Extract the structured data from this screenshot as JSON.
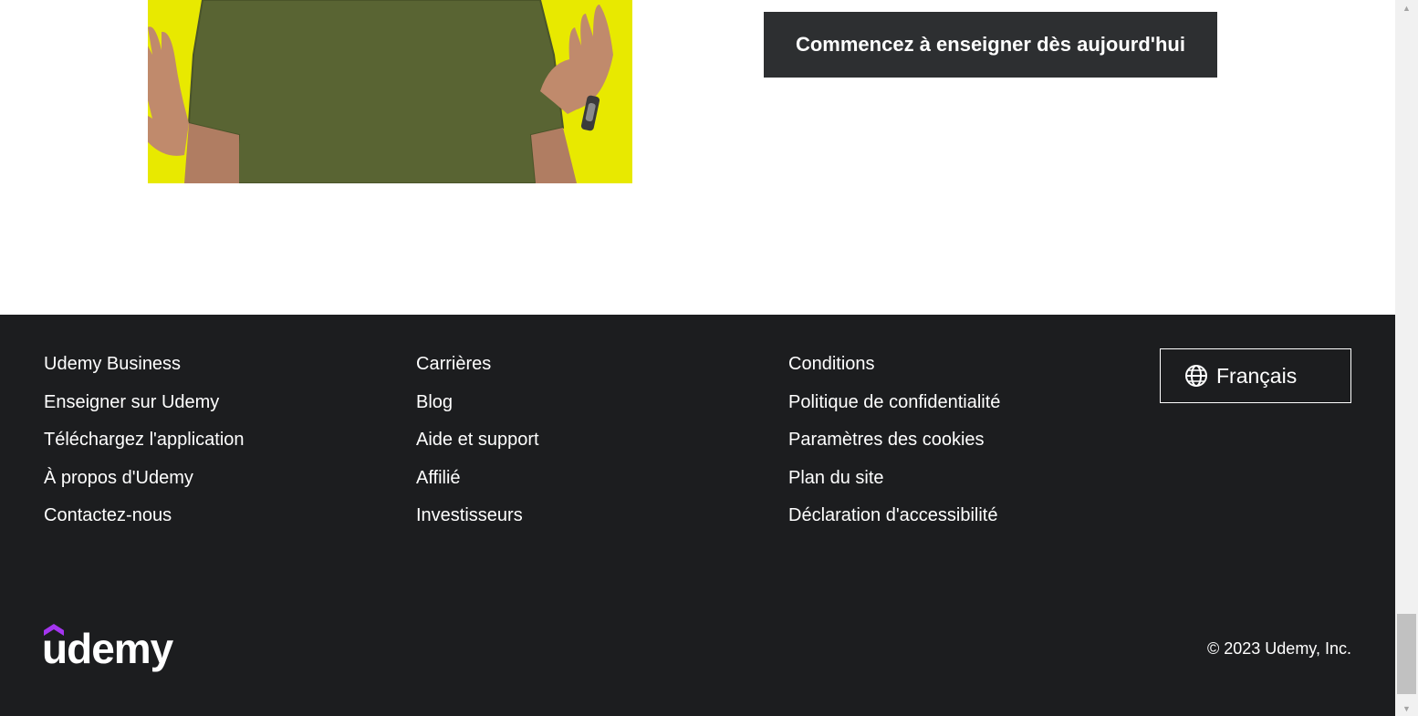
{
  "hero": {
    "cta_label": "Commencez à enseigner dès aujourd'hui",
    "image_bg_color": "#e8e900",
    "image_subject": "person in olive t-shirt gesturing with hands"
  },
  "footer": {
    "columns": [
      {
        "links": [
          "Udemy Business",
          "Enseigner sur Udemy",
          "Téléchargez l'application",
          "À propos d'Udemy",
          "Contactez-nous"
        ]
      },
      {
        "links": [
          "Carrières",
          "Blog",
          "Aide et support",
          "Affilié",
          "Investisseurs"
        ]
      },
      {
        "links": [
          "Conditions",
          "Politique de confidentialité",
          "Paramètres des cookies",
          "Plan du site",
          "Déclaration d'accessibilité"
        ]
      }
    ],
    "language_button": {
      "icon": "globe-icon",
      "label": "Français"
    },
    "logo_text": "udemy",
    "copyright": "© 2023 Udemy, Inc."
  },
  "colors": {
    "footer_bg": "#1c1d1f",
    "cta_bg": "#2d2f31",
    "logo_accent": "#a435f0"
  },
  "scrollbar": {
    "icon_up": "arrow-up-icon",
    "icon_down": "arrow-down-icon"
  }
}
